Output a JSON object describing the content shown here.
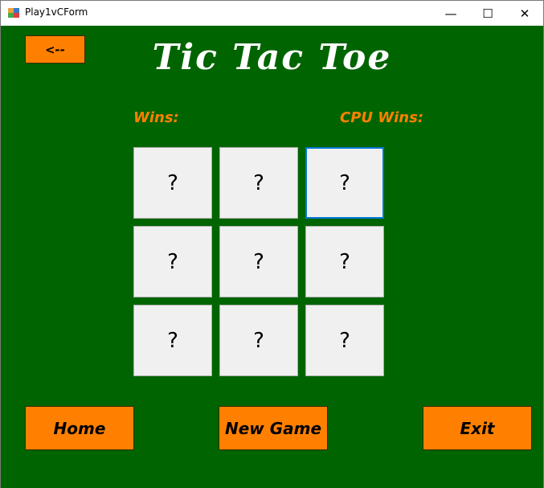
{
  "window": {
    "title": "Play1vCForm",
    "minimize_glyph": "—",
    "maximize_glyph": "☐",
    "close_glyph": "✕"
  },
  "header": {
    "back_label": "<--",
    "title": "Tic Tac Toe"
  },
  "scores": {
    "wins_label": "Wins:",
    "cpu_wins_label": "CPU Wins:"
  },
  "board": {
    "cells": [
      "?",
      "?",
      "?",
      "?",
      "?",
      "?",
      "?",
      "?",
      "?"
    ]
  },
  "buttons": {
    "home": "Home",
    "new_game": "New Game",
    "exit": "Exit"
  },
  "colors": {
    "background": "#006400",
    "accent": "#ff8000",
    "title_text": "#ffffff",
    "cell_bg": "#f0f0f0",
    "focus_border": "#0078d7"
  }
}
